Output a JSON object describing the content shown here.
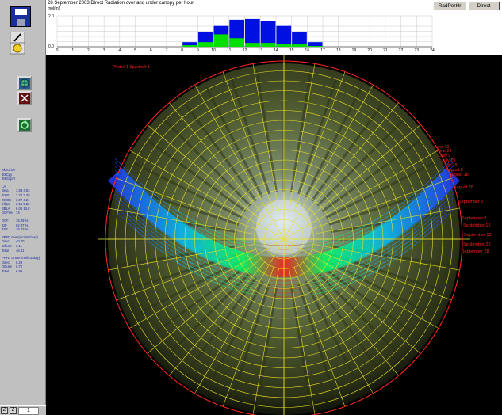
{
  "header": {
    "title": "28 September 2003   Direct Radiation over and under canopy per hour",
    "unit": "mol/m2",
    "buttons": {
      "radperhr": "RadPerHr",
      "direct": "Direct"
    }
  },
  "chart_data": {
    "type": "bar",
    "x": [
      9,
      10,
      11,
      12,
      13,
      14,
      15,
      16,
      17
    ],
    "series": [
      {
        "name": "",
        "color": "#0010e0",
        "values": [
          0.3,
          0.95,
          1.35,
          1.75,
          1.8,
          1.65,
          1.35,
          0.95,
          0.3
        ]
      },
      {
        "name": "",
        "color": "#00e000",
        "values": [
          0.1,
          0.3,
          0.8,
          0.55,
          0.25,
          0.25,
          0.2,
          0.15,
          0.05
        ]
      }
    ],
    "xticks": [
      "0",
      "1",
      "2",
      "3",
      "4",
      "5",
      "6",
      "7",
      "8",
      "9",
      "10",
      "11",
      "12",
      "13",
      "14",
      "15",
      "16",
      "17",
      "18",
      "19",
      "20",
      "21",
      "22",
      "23",
      "24"
    ],
    "ylim": [
      0,
      2
    ],
    "yticks": [
      "2.0",
      "0.0"
    ],
    "grid": true
  },
  "main": {
    "photo_label": "Photo# 1    Spectral# 1",
    "dates": [
      "June 19",
      "June 29",
      "July 9",
      "July 19",
      "July 29",
      "August 8",
      "August 18",
      "August 28",
      "September 2",
      "September 8",
      "September 12",
      "September 18",
      "September 22",
      "September 28"
    ]
  },
  "stats": {
    "groups": [
      [
        [
          "SkyGrid#",
          ""
        ],
        [
          "TotCpy",
          ""
        ],
        [
          "TotGapFr",
          ""
        ]
      ],
      [
        [
          "LAI",
          ""
        ],
        [
          "Beta",
          "3.83  4.53"
        ],
        [
          "2000",
          "2.76  3.29"
        ],
        [
          "2000E",
          "3.07  4.21"
        ],
        [
          "Ellips",
          "3.51  5.23"
        ],
        [
          "BBLA",
          "6.05  14.8"
        ],
        [
          "DGFr%",
          "74"
        ]
      ],
      [
        [
          "DCF",
          "15.29 %"
        ],
        [
          "IDF",
          "62.47 %"
        ],
        [
          "TSF",
          "16.93 %"
        ]
      ],
      [
        [
          "PPFD Over(mol/m2/day)",
          ""
        ],
        [
          "Direct",
          "40.70"
        ],
        [
          "Diffuse",
          "6.11"
        ],
        [
          "Total",
          "46.81"
        ]
      ],
      [
        [
          "PPFD Under(mol/m2/day)",
          ""
        ],
        [
          "Direct",
          "6.29"
        ],
        [
          "Diffuse",
          "0.70"
        ],
        [
          "Total",
          "6.99"
        ]
      ]
    ]
  },
  "status": {
    "page": "1",
    "box1": "Z",
    "box2": "Z"
  }
}
